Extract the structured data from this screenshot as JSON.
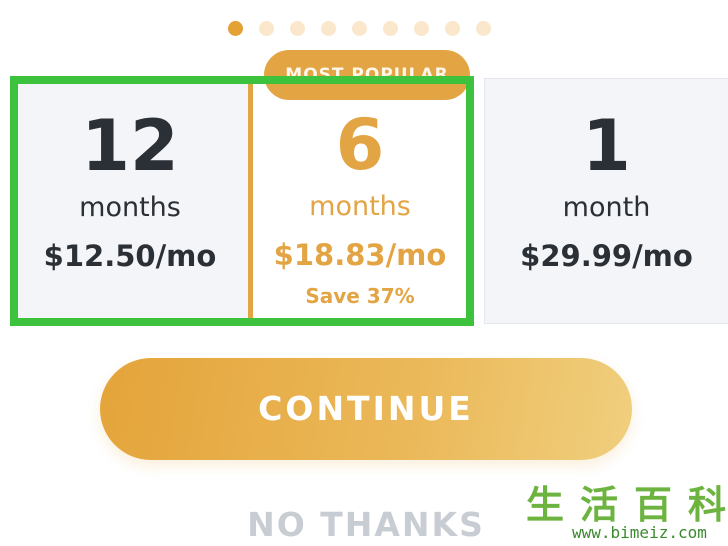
{
  "carousel": {
    "dot_count": 9,
    "active_index": 0
  },
  "badge": {
    "label": "MOST POPULAR"
  },
  "plans": [
    {
      "count": "12",
      "unit": "months",
      "price": "$12.50/mo",
      "save": ""
    },
    {
      "count": "6",
      "unit": "months",
      "price": "$18.83/mo",
      "save": "Save 37%"
    },
    {
      "count": "1",
      "unit": "month",
      "price": "$29.99/mo",
      "save": ""
    }
  ],
  "actions": {
    "continue_label": "CONTINUE",
    "no_thanks_label": "NO THANKS"
  },
  "watermark": {
    "chars": [
      "生",
      "活",
      "百",
      "科"
    ],
    "url": "www.bimeiz.com"
  },
  "colors": {
    "accent": "#e3a443",
    "highlight": "#3dc23e",
    "text_dark": "#2b2f36",
    "muted": "#c8ccd3"
  }
}
